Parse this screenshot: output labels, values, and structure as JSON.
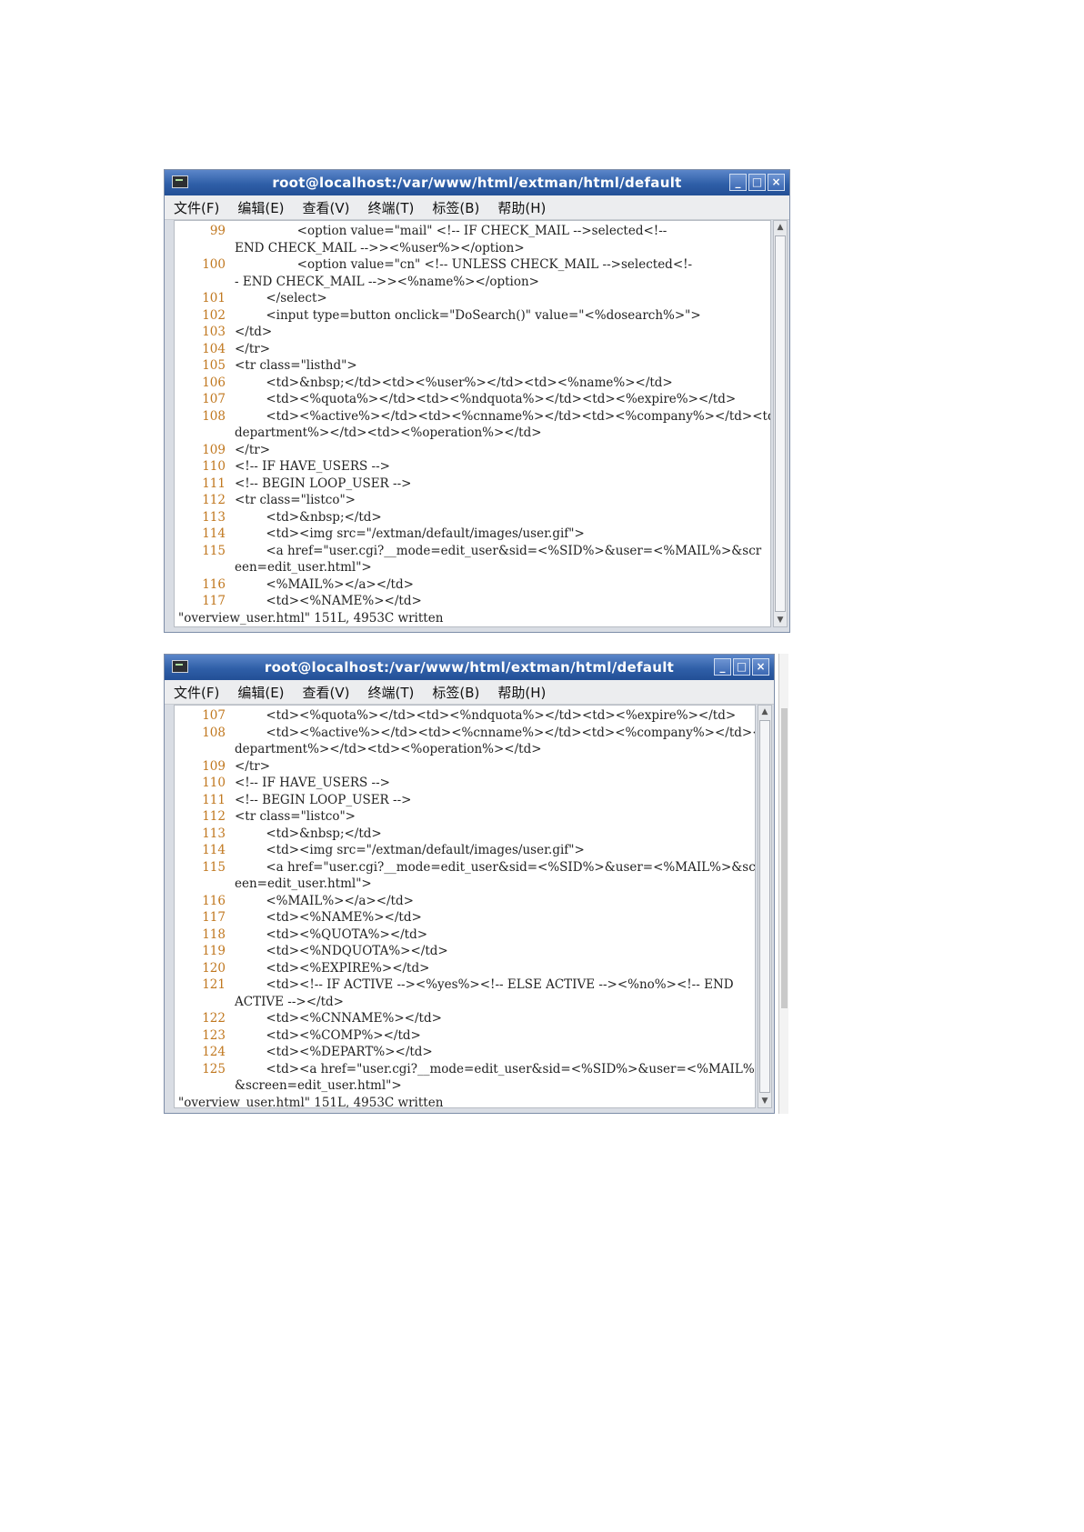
{
  "windows": [
    {
      "title": "root@localhost:/var/www/html/extman/html/default",
      "menus": [
        "文件(F)",
        "编辑(E)",
        "查看(V)",
        "终端(T)",
        "标签(B)",
        "帮助(H)"
      ],
      "buttons": {
        "minimize": "_",
        "maximize": "□",
        "close": "×"
      },
      "lines": [
        {
          "n": "99",
          "t": "\t\t<option value=\"mail\" <!-- IF CHECK_MAIL -->selected<!--"
        },
        {
          "n": "",
          "t": "END CHECK_MAIL -->><%user%></option>"
        },
        {
          "n": "100",
          "t": "\t\t<option value=\"cn\" <!-- UNLESS CHECK_MAIL -->selected<!-"
        },
        {
          "n": "",
          "t": "- END CHECK_MAIL -->><%name%></option>"
        },
        {
          "n": "101",
          "t": "\t</select>"
        },
        {
          "n": "102",
          "t": "\t<input type=button onclick=\"DoSearch()\" value=\"<%dosearch%>\">"
        },
        {
          "n": "103",
          "t": "</td>"
        },
        {
          "n": "104",
          "t": "</tr>"
        },
        {
          "n": "105",
          "t": "<tr class=\"listhd\">"
        },
        {
          "n": "106",
          "t": "\t<td>&nbsp;</td><td><%user%></td><td><%name%></td>"
        },
        {
          "n": "107",
          "t": "\t<td><%quota%></td><td><%ndquota%></td><td><%expire%></td>"
        },
        {
          "n": "108",
          "t": "\t<td><%active%></td><td><%cnname%></td><td><%company%></td><td><%"
        },
        {
          "n": "",
          "t": "department%></td><td><%operation%></td>"
        },
        {
          "n": "109",
          "t": "</tr>"
        },
        {
          "n": "110",
          "t": "<!-- IF HAVE_USERS -->"
        },
        {
          "n": "111",
          "t": "<!-- BEGIN LOOP_USER -->"
        },
        {
          "n": "112",
          "t": "<tr class=\"listco\">"
        },
        {
          "n": "113",
          "t": "\t<td>&nbsp;</td>"
        },
        {
          "n": "114",
          "t": "\t<td><img src=\"/extman/default/images/user.gif\">"
        },
        {
          "n": "115",
          "t": "\t<a href=\"user.cgi?__mode=edit_user&sid=<%SID%>&user=<%MAIL%>&scr"
        },
        {
          "n": "",
          "t": "een=edit_user.html\">"
        },
        {
          "n": "116",
          "t": "\t<%MAIL%></a></td>"
        },
        {
          "n": "117",
          "t": "\t<td><%NAME%></td>"
        }
      ],
      "status": "\"overview_user.html\" 151L, 4953C written"
    },
    {
      "title": "root@localhost:/var/www/html/extman/html/default",
      "menus": [
        "文件(F)",
        "编辑(E)",
        "查看(V)",
        "终端(T)",
        "标签(B)",
        "帮助(H)"
      ],
      "buttons": {
        "minimize": "_",
        "maximize": "□",
        "close": "×"
      },
      "lines": [
        {
          "n": "107",
          "t": "\t<td><%quota%></td><td><%ndquota%></td><td><%expire%></td>"
        },
        {
          "n": "108",
          "t": "\t<td><%active%></td><td><%cnname%></td><td><%company%></td><td><%"
        },
        {
          "n": "",
          "t": "department%></td><td><%operation%></td>"
        },
        {
          "n": "109",
          "t": "</tr>"
        },
        {
          "n": "110",
          "t": "<!-- IF HAVE_USERS -->"
        },
        {
          "n": "111",
          "t": "<!-- BEGIN LOOP_USER -->"
        },
        {
          "n": "112",
          "t": "<tr class=\"listco\">"
        },
        {
          "n": "113",
          "t": "\t<td>&nbsp;</td>"
        },
        {
          "n": "114",
          "t": "\t<td><img src=\"/extman/default/images/user.gif\">"
        },
        {
          "n": "115",
          "t": "\t<a href=\"user.cgi?__mode=edit_user&sid=<%SID%>&user=<%MAIL%>&scr"
        },
        {
          "n": "",
          "t": "een=edit_user.html\">"
        },
        {
          "n": "116",
          "t": "\t<%MAIL%></a></td>"
        },
        {
          "n": "117",
          "t": "\t<td><%NAME%></td>"
        },
        {
          "n": "118",
          "t": "\t<td><%QUOTA%></td>"
        },
        {
          "n": "119",
          "t": "\t<td><%NDQUOTA%></td>"
        },
        {
          "n": "120",
          "t": "\t<td><%EXPIRE%></td>"
        },
        {
          "n": "121",
          "t": "\t<td><!-- IF ACTIVE --><%yes%><!-- ELSE ACTIVE --><%no%><!-- END"
        },
        {
          "n": "",
          "t": "ACTIVE --></td>"
        },
        {
          "n": "122",
          "t": "\t<td><%CNNAME%></td>"
        },
        {
          "n": "123",
          "t": "\t<td><%COMP%></td>"
        },
        {
          "n": "124",
          "t": "\t<td><%DEPART%></td>"
        },
        {
          "n": "125",
          "t": "\t<td><a href=\"user.cgi?__mode=edit_user&sid=<%SID%>&user=<%MAIL%>"
        },
        {
          "n": "",
          "t": "&screen=edit_user.html\">"
        }
      ],
      "status": "\"overview_user.html\" 151L, 4953C written"
    }
  ]
}
